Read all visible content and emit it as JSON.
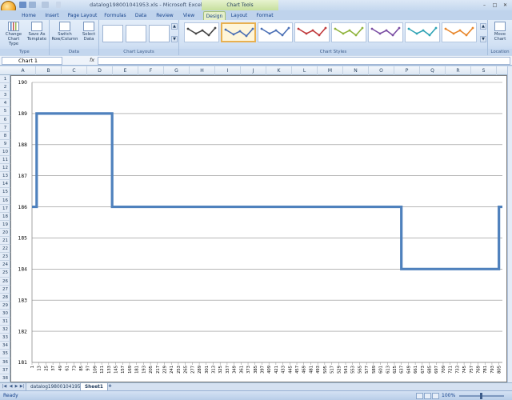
{
  "window": {
    "title": "datalog198001041953.xls - Microsoft Excel",
    "context_tab_group": "Chart Tools",
    "controls": [
      "–",
      "□",
      "✕"
    ]
  },
  "tabs": [
    "Home",
    "Insert",
    "Page Layout",
    "Formulas",
    "Data",
    "Review",
    "View",
    "Design",
    "Layout",
    "Format"
  ],
  "active_tab": "Design",
  "ribbon": {
    "type_group": {
      "label": "Type",
      "buttons": [
        "Change Chart Type",
        "Save As Template"
      ]
    },
    "data_group": {
      "label": "Data",
      "buttons": [
        "Switch Row/Column",
        "Select Data"
      ]
    },
    "layouts_group": {
      "label": "Chart Layouts"
    },
    "styles_group": {
      "label": "Chart Styles",
      "colors": [
        "#444444",
        "#4a6fb5",
        "#4a6fb5",
        "#c0393b",
        "#8fb33a",
        "#7a4da3",
        "#2fa3b5",
        "#e8862a"
      ],
      "selected_index": 1
    },
    "location_group": {
      "label": "Location",
      "buttons": [
        "Move Chart"
      ]
    }
  },
  "formula_bar": {
    "name_box": "Chart 1",
    "fx": "fx",
    "content": ""
  },
  "columns": [
    "A",
    "B",
    "C",
    "D",
    "E",
    "F",
    "G",
    "H",
    "I",
    "J",
    "K",
    "L",
    "M",
    "N",
    "O",
    "P",
    "Q",
    "R",
    "S"
  ],
  "rows": [
    "1",
    "2",
    "3",
    "4",
    "5",
    "6",
    "7",
    "8",
    "9",
    "10",
    "11",
    "12",
    "13",
    "14",
    "15",
    "16",
    "17",
    "18",
    "19",
    "20",
    "21",
    "22",
    "23",
    "24",
    "25",
    "26",
    "27",
    "28",
    "29",
    "30",
    "31",
    "32",
    "33",
    "34",
    "35",
    "36",
    "37",
    "38"
  ],
  "chart_data": {
    "type": "line",
    "title": "",
    "xlabel": "",
    "ylabel": "",
    "ylim": [
      181,
      190
    ],
    "yticks": [
      181,
      182,
      183,
      184,
      185,
      186,
      187,
      188,
      189,
      190
    ],
    "xlim": [
      1,
      811
    ],
    "xticks": [
      1,
      13,
      25,
      37,
      49,
      61,
      73,
      85,
      97,
      109,
      121,
      133,
      145,
      157,
      169,
      181,
      193,
      205,
      217,
      229,
      241,
      253,
      265,
      277,
      289,
      301,
      313,
      325,
      337,
      349,
      361,
      373,
      385,
      397,
      409,
      421,
      433,
      445,
      457,
      469,
      481,
      493,
      505,
      517,
      529,
      541,
      553,
      565,
      577,
      589,
      601,
      613,
      625,
      637,
      649,
      661,
      673,
      685,
      697,
      709,
      721,
      733,
      745,
      757,
      769,
      781,
      793,
      805
    ],
    "color": "#4f81bd",
    "grid": true,
    "legend": "none",
    "series": [
      {
        "x": [
          1,
          9,
          9,
          139,
          139,
          637,
          637,
          805,
          805,
          811
        ],
        "y": [
          186,
          186,
          189,
          189,
          186,
          186,
          184,
          184,
          186,
          186
        ]
      }
    ]
  },
  "sheet_tabs": [
    "datalog198001041953",
    "Sheet1"
  ],
  "active_sheet": "Sheet1",
  "status": {
    "text": "Ready",
    "zoom": "100%"
  }
}
